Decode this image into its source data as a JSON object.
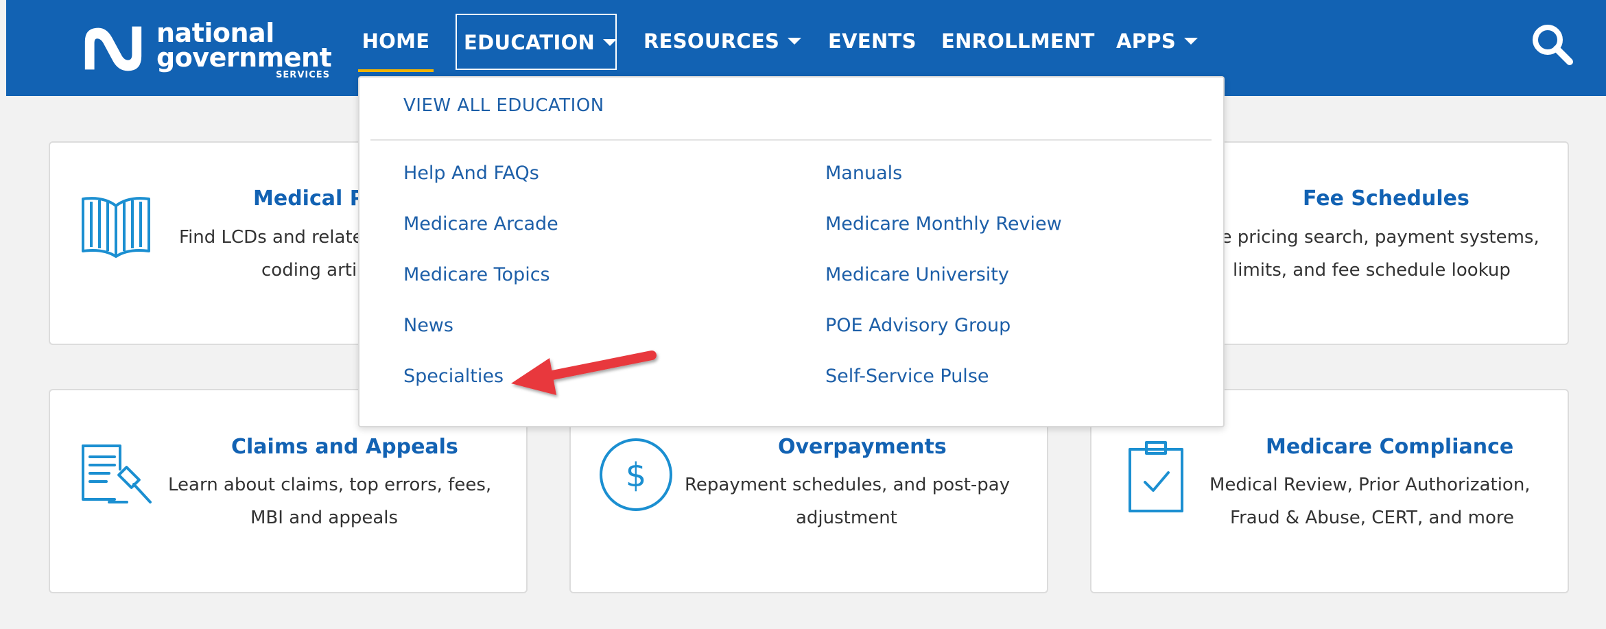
{
  "header": {
    "logo": {
      "line1": "national",
      "line2": "government",
      "line3": "SERVICES"
    },
    "nav": [
      {
        "label": "HOME"
      },
      {
        "label": "EDUCATION"
      },
      {
        "label": "RESOURCES"
      },
      {
        "label": "EVENTS"
      },
      {
        "label": "ENROLLMENT"
      },
      {
        "label": "APPS"
      }
    ],
    "search_icon": "search-icon"
  },
  "dropdown": {
    "view_all": "VIEW ALL EDUCATION",
    "left_links": [
      "Help And FAQs",
      "Medicare Arcade",
      "Medicare Topics",
      "News",
      "Specialties"
    ],
    "right_links": [
      "Manuals",
      "Medicare Monthly Review",
      "Medicare University",
      "POE Advisory Group",
      "Self-Service Pulse"
    ]
  },
  "cards": [
    {
      "title": "Medical Po",
      "desc1": "Find LCDs and relate",
      "desc2": "coding arti",
      "icon": "book-icon"
    },
    {
      "title": "Fee Schedules",
      "desc1": "de pricing search, payment systems,",
      "desc2": "limits, and fee schedule lookup",
      "icon": ""
    },
    {
      "title": "Claims and Appeals",
      "desc1": "Learn about claims, top errors, fees,",
      "desc2": "MBI and appeals",
      "icon": "document-gavel-icon"
    },
    {
      "title": "Overpayments",
      "desc1": "Repayment schedules, and post-pay",
      "desc2": "adjustment",
      "icon": "dollar-circle-icon"
    },
    {
      "title": "Medicare Compliance",
      "desc1": "Medical Review, Prior Authorization,",
      "desc2": "Fraud & Abuse, CERT, and more",
      "icon": "clipboard-check-icon"
    }
  ],
  "colors": {
    "header_bg": "#1262b3",
    "accent_underline": "#f2b300",
    "link": "#1d5fa8",
    "icon": "#1b8fd1",
    "annotation_arrow": "#e8383d"
  }
}
